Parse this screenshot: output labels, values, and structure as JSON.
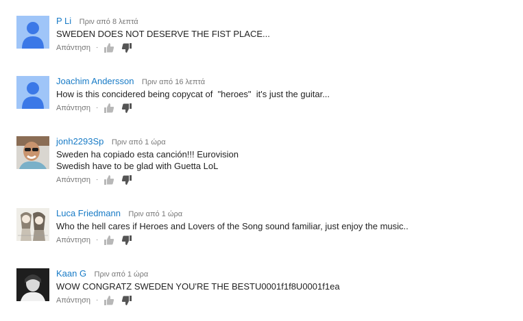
{
  "strings": {
    "reply_label": "Απάντηση",
    "dot": "·"
  },
  "comments": [
    {
      "author": "P Li",
      "time": "Πριν από 8 λεπτά",
      "lines": [
        "SWEDEN DOES NOT DESERVE THE FIST PLACE..."
      ],
      "avatar": "default-avatar"
    },
    {
      "author": "Joachim Andersson",
      "time": "Πριν από 16 λεπτά",
      "lines": [
        "How is this concidered being copycat of  \"heroes\"  it's just the guitar..."
      ],
      "avatar": "default-avatar"
    },
    {
      "author": "jonh2293Sp",
      "time": "Πριν από 1 ώρα",
      "lines": [
        "Sweden ha copiado esta canción!!! Eurovision",
        "Swedish have to be glad with Guetta LoL"
      ],
      "avatar": "photo-avatar"
    },
    {
      "author": "Luca Friedmann",
      "time": "Πριν από 1 ώρα",
      "lines": [
        "Who the hell cares if Heroes and Lovers of the Song sound familiar, just enjoy the music.."
      ],
      "avatar": "drawing-avatar"
    },
    {
      "author": "Kaan G",
      "time": "Πριν από 1 ώρα",
      "lines": [
        "WOW CONGRATZ SWEDEN YOU'RE THE BESTU0001f1f8U0001f1ea"
      ],
      "avatar": "photo-avatar"
    }
  ],
  "colors": {
    "author": "#167ac6",
    "text": "#222222",
    "meta": "#767676",
    "default_avatar_bg": "#9fc5f8",
    "default_avatar_fg": "#3b78e7"
  }
}
